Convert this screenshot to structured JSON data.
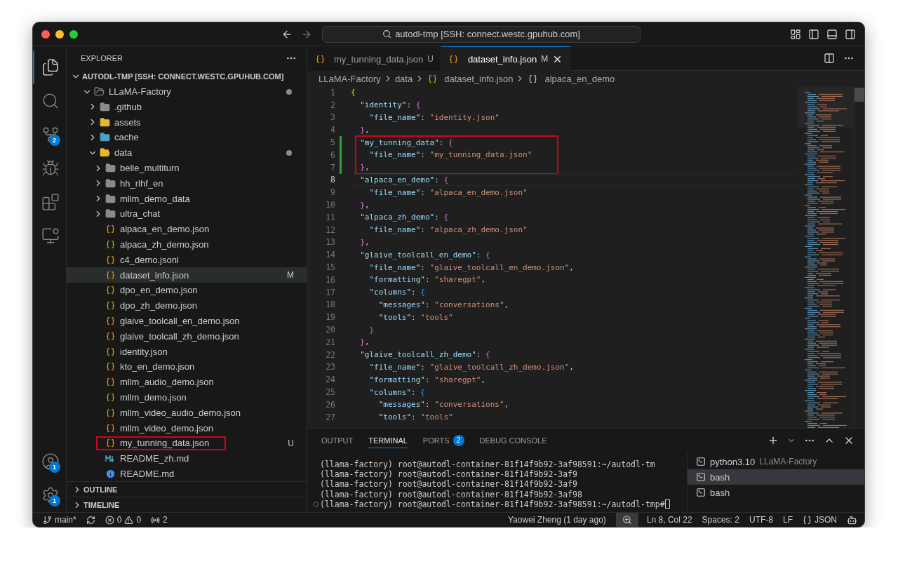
{
  "window": {
    "title": "autodl-tmp [SSH: connect.westc.gpuhub.com]"
  },
  "activity_bar": [
    {
      "kind": "files",
      "selected": true
    },
    {
      "kind": "search",
      "selected": false
    },
    {
      "kind": "source-control",
      "selected": false,
      "badge": "2"
    },
    {
      "kind": "run-debug",
      "selected": false
    },
    {
      "kind": "extensions",
      "selected": false
    },
    {
      "kind": "remote",
      "selected": false
    }
  ],
  "activity_bar_bottom": [
    {
      "kind": "accounts",
      "badge": "1"
    },
    {
      "kind": "settings",
      "badge": "1"
    }
  ],
  "sidebar": {
    "title": "EXPLORER",
    "root": "AUTODL-TMP [SSH: CONNECT.WESTC.GPUHUB.COM]",
    "tree": [
      {
        "name": "LLaMA-Factory",
        "kind": "folder-open",
        "expanded": true,
        "dot": true,
        "selected": false,
        "children": [
          {
            "name": ".github",
            "kind": "folder-github",
            "expanded": false,
            "selected": false
          },
          {
            "name": "assets",
            "kind": "folder-assets",
            "expanded": false,
            "selected": false
          },
          {
            "name": "cache",
            "kind": "folder-cache",
            "expanded": false,
            "selected": false
          },
          {
            "name": "data",
            "kind": "folder-data",
            "expanded": true,
            "dot": true,
            "selected": false,
            "children": [
              {
                "name": "belle_multiturn",
                "kind": "folder",
                "expanded": false,
                "selected": false
              },
              {
                "name": "hh_rlhf_en",
                "kind": "folder",
                "expanded": false,
                "selected": false
              },
              {
                "name": "mllm_demo_data",
                "kind": "folder",
                "expanded": false,
                "selected": false
              },
              {
                "name": "ultra_chat",
                "kind": "folder",
                "expanded": false,
                "selected": false
              },
              {
                "name": "alpaca_en_demo.json",
                "kind": "json",
                "selected": false
              },
              {
                "name": "alpaca_zh_demo.json",
                "kind": "json",
                "selected": false
              },
              {
                "name": "c4_demo.jsonl",
                "kind": "json",
                "selected": false
              },
              {
                "name": "dataset_info.json",
                "kind": "json",
                "selected": true,
                "badge": "M"
              },
              {
                "name": "dpo_en_demo.json",
                "kind": "json",
                "selected": false
              },
              {
                "name": "dpo_zh_demo.json",
                "kind": "json",
                "selected": false
              },
              {
                "name": "glaive_toolcall_en_demo.json",
                "kind": "json",
                "selected": false
              },
              {
                "name": "glaive_toolcall_zh_demo.json",
                "kind": "json",
                "selected": false
              },
              {
                "name": "identity.json",
                "kind": "json",
                "selected": false
              },
              {
                "name": "kto_en_demo.json",
                "kind": "json",
                "selected": false
              },
              {
                "name": "mllm_audio_demo.json",
                "kind": "json",
                "selected": false
              },
              {
                "name": "mllm_demo.json",
                "kind": "json",
                "selected": false
              },
              {
                "name": "mllm_video_audio_demo.json",
                "kind": "json",
                "selected": false
              },
              {
                "name": "mllm_video_demo.json",
                "kind": "json",
                "selected": false
              },
              {
                "name": "my_tunning_data.json",
                "kind": "json",
                "selected": false,
                "badge": "U",
                "boxed": true
              },
              {
                "name": "README_zh.md",
                "kind": "markdown",
                "selected": false
              },
              {
                "name": "README.md",
                "kind": "info",
                "selected": false
              }
            ]
          }
        ]
      }
    ]
  },
  "sections": [
    {
      "label": "OUTLINE",
      "expanded": false
    },
    {
      "label": "TIMELINE",
      "expanded": false
    }
  ],
  "tabs": [
    {
      "label": "my_tunning_data.json",
      "status": "U",
      "selected": false
    },
    {
      "label": "dataset_info.json",
      "status": "M",
      "selected": true
    }
  ],
  "breadcrumb": [
    {
      "label": "LLaMA-Factory",
      "kind": "plain"
    },
    {
      "label": "data",
      "kind": "plain"
    },
    {
      "label": "dataset_info.json",
      "kind": "json"
    },
    {
      "label": "alpaca_en_demo",
      "kind": "object"
    }
  ],
  "code": [
    {
      "number": "1",
      "tokens": [
        {
          "kind": "b1",
          "text": "{"
        }
      ]
    },
    {
      "number": "2",
      "tokens": [
        {
          "kind": "key",
          "text": "  \"identity\""
        },
        {
          "kind": "plain",
          "text": ": "
        },
        {
          "kind": "b2",
          "text": "{"
        }
      ]
    },
    {
      "number": "3",
      "tokens": [
        {
          "kind": "key",
          "text": "    \"file_name\""
        },
        {
          "kind": "plain",
          "text": ": "
        },
        {
          "kind": "string",
          "text": "\"identity.json\""
        }
      ]
    },
    {
      "number": "4",
      "tokens": [
        {
          "kind": "b2",
          "text": "  }"
        },
        {
          "kind": "plain",
          "text": ","
        }
      ]
    },
    {
      "number": "5",
      "modified": true,
      "boxed": true,
      "tokens": [
        {
          "kind": "key",
          "text": "  \"my_tunning_data\""
        },
        {
          "kind": "plain",
          "text": ": "
        },
        {
          "kind": "b2",
          "text": "{"
        }
      ]
    },
    {
      "number": "6",
      "modified": true,
      "boxed": true,
      "tokens": [
        {
          "kind": "key",
          "text": "    \"file_name\""
        },
        {
          "kind": "plain",
          "text": ": "
        },
        {
          "kind": "string",
          "text": "\"my_tunning_data.json\""
        }
      ]
    },
    {
      "number": "7",
      "modified": true,
      "boxed": true,
      "tokens": [
        {
          "kind": "b2",
          "text": "  }"
        },
        {
          "kind": "plain",
          "text": ","
        }
      ]
    },
    {
      "number": "8",
      "current": true,
      "tokens": [
        {
          "kind": "key",
          "text": "  \"alpaca_en_demo\""
        },
        {
          "kind": "plain",
          "text": ": "
        },
        {
          "kind": "b2",
          "text": "{"
        }
      ]
    },
    {
      "number": "9",
      "tokens": [
        {
          "kind": "key",
          "text": "    \"file_name\""
        },
        {
          "kind": "plain",
          "text": ": "
        },
        {
          "kind": "string",
          "text": "\"alpaca_en_demo.json\""
        }
      ]
    },
    {
      "number": "10",
      "tokens": [
        {
          "kind": "b2",
          "text": "  }"
        },
        {
          "kind": "plain",
          "text": ","
        }
      ]
    },
    {
      "number": "11",
      "tokens": [
        {
          "kind": "key",
          "text": "  \"alpaca_zh_demo\""
        },
        {
          "kind": "plain",
          "text": ": "
        },
        {
          "kind": "b2",
          "text": "{"
        }
      ]
    },
    {
      "number": "12",
      "tokens": [
        {
          "kind": "key",
          "text": "    \"file_name\""
        },
        {
          "kind": "plain",
          "text": ": "
        },
        {
          "kind": "string",
          "text": "\"alpaca_zh_demo.json\""
        }
      ]
    },
    {
      "number": "13",
      "tokens": [
        {
          "kind": "b2",
          "text": "  }"
        },
        {
          "kind": "plain",
          "text": ","
        }
      ]
    },
    {
      "number": "14",
      "tokens": [
        {
          "kind": "key",
          "text": "  \"glaive_toolcall_en_demo\""
        },
        {
          "kind": "plain",
          "text": ": "
        },
        {
          "kind": "b2",
          "text": "{"
        }
      ]
    },
    {
      "number": "15",
      "tokens": [
        {
          "kind": "key",
          "text": "    \"file_name\""
        },
        {
          "kind": "plain",
          "text": ": "
        },
        {
          "kind": "string",
          "text": "\"glaive_toolcall_en_demo.json\""
        },
        {
          "kind": "plain",
          "text": ","
        }
      ]
    },
    {
      "number": "16",
      "tokens": [
        {
          "kind": "key",
          "text": "    \"formatting\""
        },
        {
          "kind": "plain",
          "text": ": "
        },
        {
          "kind": "string",
          "text": "\"sharegpt\""
        },
        {
          "kind": "plain",
          "text": ","
        }
      ]
    },
    {
      "number": "17",
      "tokens": [
        {
          "kind": "key",
          "text": "    \"columns\""
        },
        {
          "kind": "plain",
          "text": ": "
        },
        {
          "kind": "b3",
          "text": "{"
        }
      ]
    },
    {
      "number": "18",
      "tokens": [
        {
          "kind": "key",
          "text": "      \"messages\""
        },
        {
          "kind": "plain",
          "text": ": "
        },
        {
          "kind": "string",
          "text": "\"conversations\""
        },
        {
          "kind": "plain",
          "text": ","
        }
      ]
    },
    {
      "number": "19",
      "tokens": [
        {
          "kind": "key",
          "text": "      \"tools\""
        },
        {
          "kind": "plain",
          "text": ": "
        },
        {
          "kind": "string",
          "text": "\"tools\""
        }
      ]
    },
    {
      "number": "20",
      "tokens": [
        {
          "kind": "b3",
          "text": "    }"
        }
      ]
    },
    {
      "number": "21",
      "tokens": [
        {
          "kind": "b2",
          "text": "  }"
        },
        {
          "kind": "plain",
          "text": ","
        }
      ]
    },
    {
      "number": "22",
      "tokens": [
        {
          "kind": "key",
          "text": "  \"glaive_toolcall_zh_demo\""
        },
        {
          "kind": "plain",
          "text": ": "
        },
        {
          "kind": "b2",
          "text": "{"
        }
      ]
    },
    {
      "number": "23",
      "tokens": [
        {
          "kind": "key",
          "text": "    \"file_name\""
        },
        {
          "kind": "plain",
          "text": ": "
        },
        {
          "kind": "string",
          "text": "\"glaive_toolcall_zh_demo.json\""
        },
        {
          "kind": "plain",
          "text": ","
        }
      ]
    },
    {
      "number": "24",
      "tokens": [
        {
          "kind": "key",
          "text": "    \"formatting\""
        },
        {
          "kind": "plain",
          "text": ": "
        },
        {
          "kind": "string",
          "text": "\"sharegpt\""
        },
        {
          "kind": "plain",
          "text": ","
        }
      ]
    },
    {
      "number": "25",
      "tokens": [
        {
          "kind": "key",
          "text": "    \"columns\""
        },
        {
          "kind": "plain",
          "text": ": "
        },
        {
          "kind": "b3",
          "text": "{"
        }
      ]
    },
    {
      "number": "26",
      "tokens": [
        {
          "kind": "key",
          "text": "      \"messages\""
        },
        {
          "kind": "plain",
          "text": ": "
        },
        {
          "kind": "string",
          "text": "\"conversations\""
        },
        {
          "kind": "plain",
          "text": ","
        }
      ]
    },
    {
      "number": "27",
      "tokens": [
        {
          "kind": "key",
          "text": "      \"tools\""
        },
        {
          "kind": "plain",
          "text": ": "
        },
        {
          "kind": "string",
          "text": "\"tools\""
        }
      ]
    }
  ],
  "panel": {
    "tabs": [
      {
        "label": "OUTPUT",
        "selected": false
      },
      {
        "label": "TERMINAL",
        "selected": true
      },
      {
        "label": "PORTS",
        "selected": false,
        "badge": "2"
      },
      {
        "label": "DEBUG CONSOLE",
        "selected": false
      }
    ],
    "terminal_lines": [
      {
        "text": "(llama-factory) root@autodl-container-81f14f9b92-3af98591:~/autodl-tm",
        "cursor": false
      },
      {
        "text": "(llama-factory) root@autodl-container-81f14f9b92-3af9",
        "cursor": false
      },
      {
        "text": "(llama-factory) root@autodl-container-81f14f9b92-3af9",
        "cursor": false
      },
      {
        "text": "(llama-factory) root@autodl-container-81f14f9b92-3af98",
        "cursor": false
      },
      {
        "text": "(llama-factory) root@autodl-container-81f14f9b92-3af98591:~/autodl-tmp#",
        "cursor": true
      }
    ],
    "terminals": [
      {
        "name": "python3.10",
        "detail": "LLaMA-Factory",
        "selected": false
      },
      {
        "name": "bash",
        "selected": true
      },
      {
        "name": "bash",
        "selected": false
      }
    ]
  },
  "status_bar": {
    "branch": "main*",
    "errors": "0",
    "warnings": "0",
    "ports": "2",
    "blame": "Yaowei Zheng (1 day ago)",
    "position": "Ln 8, Col 22",
    "indent": "Spaces: 2",
    "encoding": "UTF-8",
    "eol": "LF",
    "language": "JSON"
  }
}
